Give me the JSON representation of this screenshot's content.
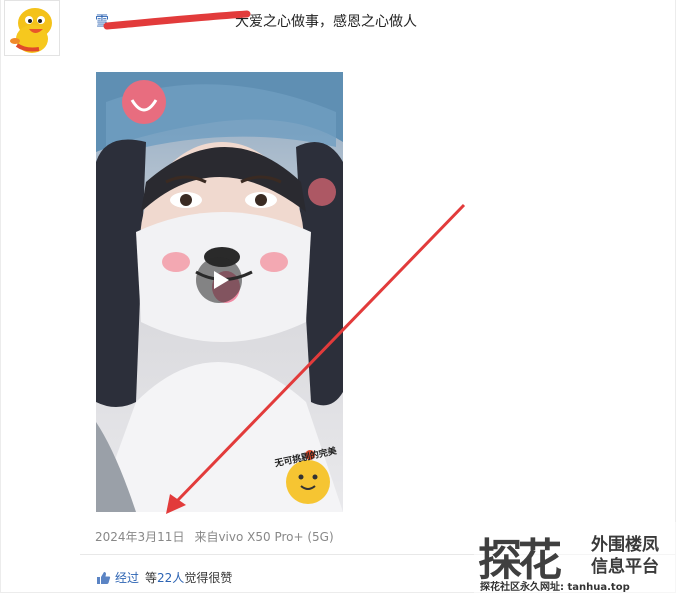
{
  "post": {
    "username": "雪",
    "text": "大爱之心做事，感恩之心做人"
  },
  "video": {
    "sticker_text": "无可挑剔的完美"
  },
  "meta": {
    "date": "2024年3月11日",
    "source": "来自vivo X50 Pro+ (5G)"
  },
  "likes": {
    "label": "经过",
    "prefix": "等",
    "count": "22人",
    "suffix": "觉得很赞"
  },
  "watermark": {
    "logo": "探花",
    "title_line1": "外围楼凤",
    "title_line2": "信息平台",
    "url": "探花社区永久网址: tanhua.top"
  },
  "colors": {
    "link": "#2d64b3",
    "annotation": "#e23b3b"
  }
}
